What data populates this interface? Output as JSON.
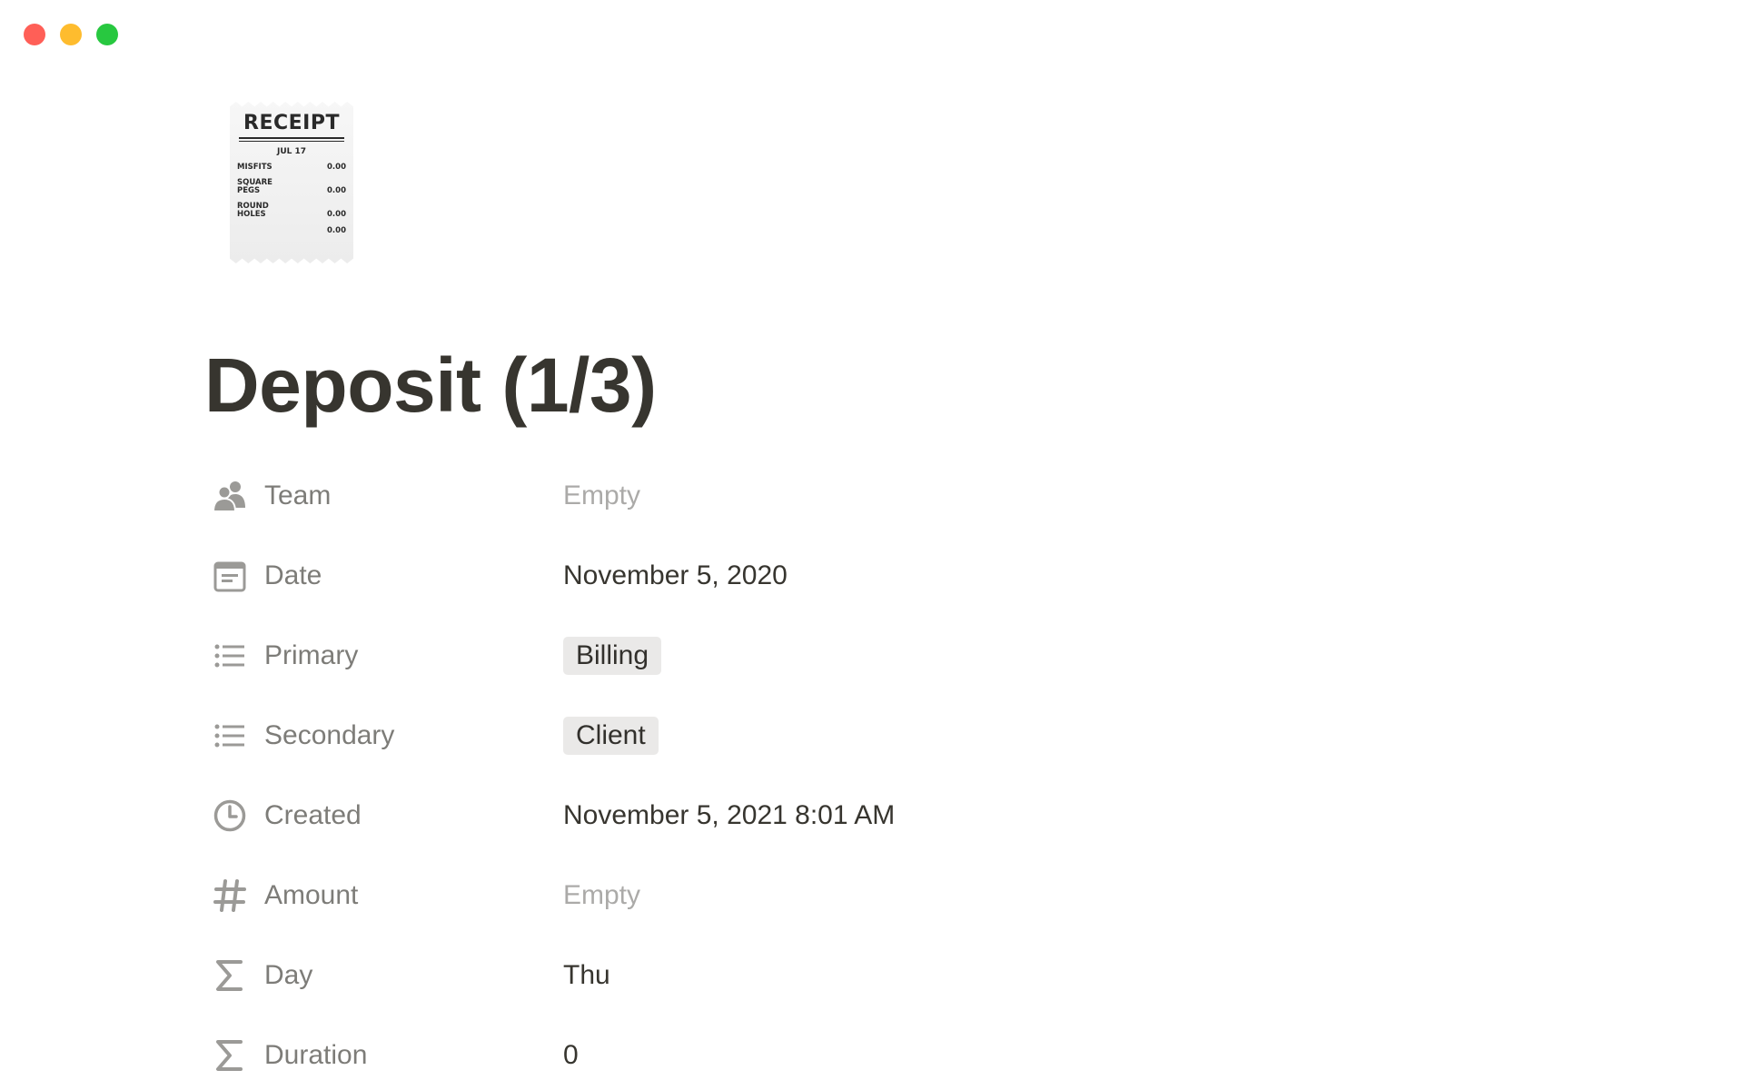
{
  "window": {
    "buttons": [
      "close",
      "minimize",
      "maximize"
    ]
  },
  "page": {
    "icon": {
      "name": "receipt-icon",
      "title": "RECEIPT",
      "date": "JUL 17",
      "lines": [
        {
          "name": "MISFITS",
          "value": "0.00"
        },
        {
          "name": "SQUARE\nPEGS",
          "value": "0.00"
        },
        {
          "name": "ROUND\nHOLES",
          "value": "0.00"
        }
      ],
      "total": "0.00"
    },
    "title": "Deposit (1/3)",
    "properties": [
      {
        "label": "Team",
        "icon": "people-icon",
        "value": "Empty",
        "empty": true
      },
      {
        "label": "Date",
        "icon": "calendar-icon",
        "value": "November 5, 2020"
      },
      {
        "label": "Primary",
        "icon": "list-icon",
        "value": "Billing",
        "tag": true
      },
      {
        "label": "Secondary",
        "icon": "list-icon",
        "value": "Client",
        "tag": true
      },
      {
        "label": "Created",
        "icon": "clock-icon",
        "value": "November 5, 2021 8:01 AM"
      },
      {
        "label": "Amount",
        "icon": "number-icon",
        "value": "Empty",
        "empty": true
      },
      {
        "label": "Day",
        "icon": "sigma-icon",
        "value": "Thu"
      },
      {
        "label": "Duration",
        "icon": "sigma-icon",
        "value": "0"
      }
    ]
  }
}
